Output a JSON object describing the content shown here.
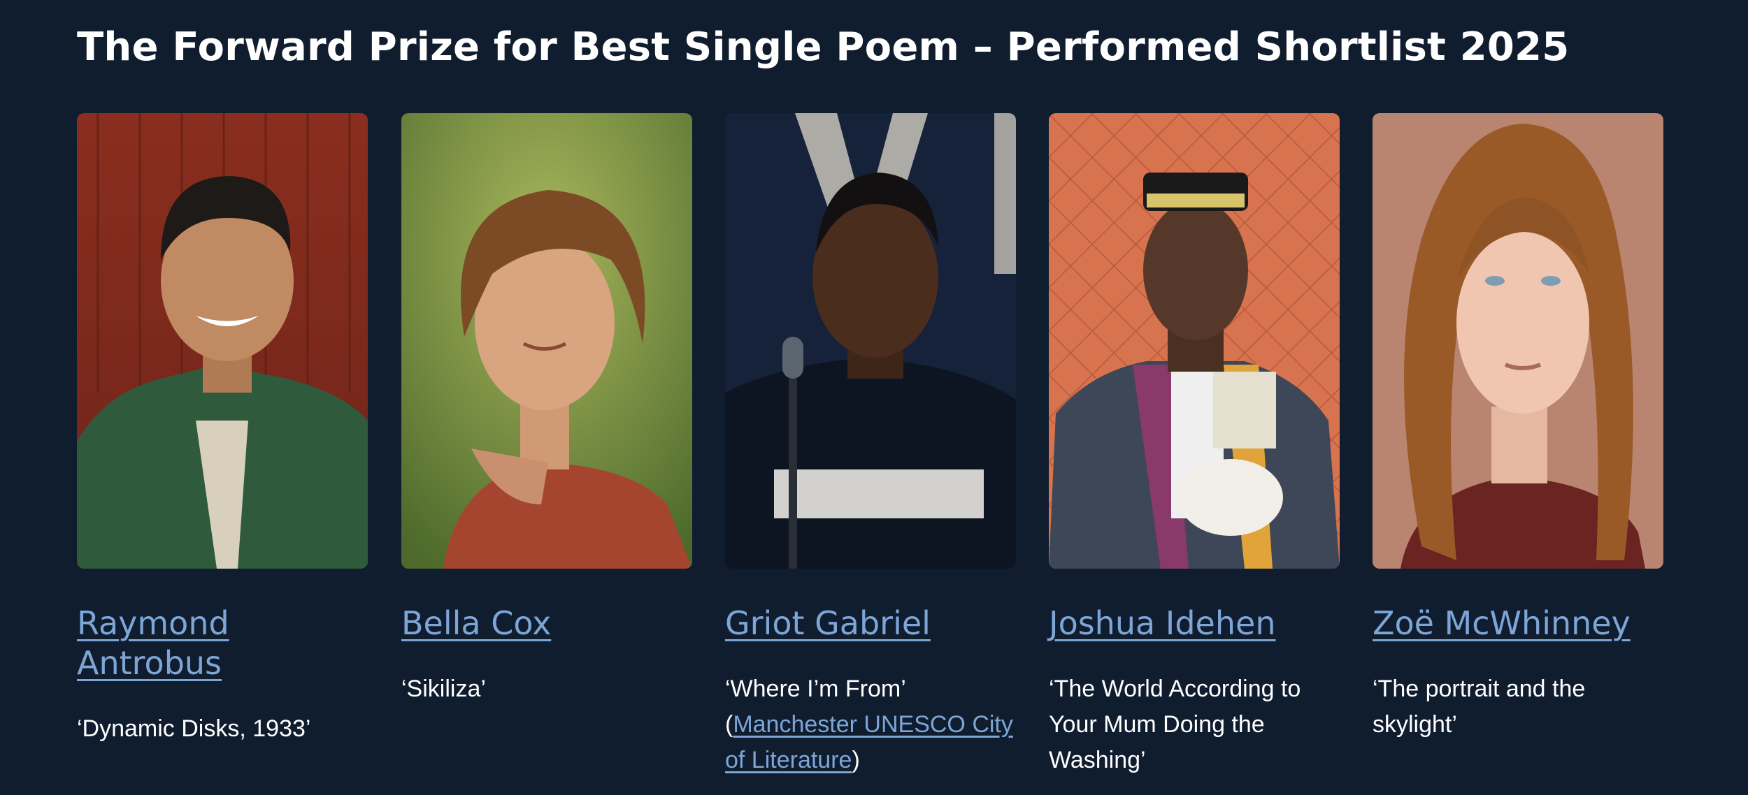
{
  "page": {
    "title": "The Forward Prize for Best Single Poem – Performed Shortlist 2025"
  },
  "cards": [
    {
      "name_line1": "Raymond",
      "name_line2": "Antrobus",
      "poem": "‘Dynamic Disks, 1933’",
      "photo_icon": "portrait-photo"
    },
    {
      "name": "Bella Cox",
      "poem": "‘Sikiliza’",
      "photo_icon": "portrait-photo"
    },
    {
      "name": "Griot Gabriel",
      "poem": "‘Where I’m From’",
      "open_paren": "(",
      "link": "Manchester UNESCO City of Literature",
      "close_paren": ")",
      "photo_icon": "portrait-photo"
    },
    {
      "name": "Joshua Idehen",
      "poem": "‘The World According to Your Mum Doing the Washing’",
      "photo_icon": "portrait-photo"
    },
    {
      "name": "Zoë McWhinney",
      "poem": "‘The portrait and the skylight’",
      "photo_icon": "portrait-photo"
    }
  ],
  "colors": {
    "background": "#0f1d2f",
    "link": "#7da5d6",
    "text": "#ffffff"
  }
}
